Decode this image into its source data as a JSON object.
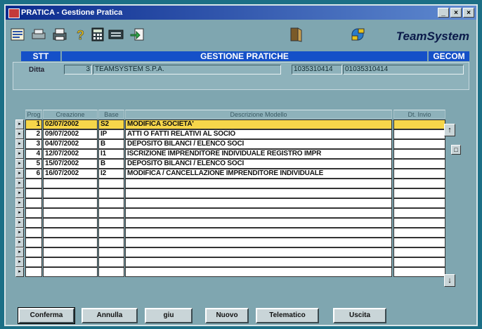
{
  "window": {
    "title": "PRATICA - Gestione Pratica",
    "controls": [
      "_",
      "×",
      "×"
    ]
  },
  "toolbar": {
    "brand": "TeamSystem"
  },
  "header": {
    "left": "STT",
    "center": "GESTIONE PRATICHE",
    "right": "GECOM",
    "ditta_label": "Ditta",
    "ditta_code": "3",
    "ditta_name": "TEAMSYSTEM S.P.A.",
    "piva": "1035310414",
    "cf": "01035310414"
  },
  "grid": {
    "columns": [
      "Prog",
      "Creazione",
      "Base",
      "Descrizione Modello",
      "Dt. Invio"
    ],
    "rows": [
      {
        "prog": "1",
        "data": "02/07/2002",
        "base": "S2",
        "desc": "MODIFICA SOCIETA'",
        "invio": ""
      },
      {
        "prog": "2",
        "data": "09/07/2002",
        "base": "IP",
        "desc": "ATTI O FATTI RELATIVI AL SOCIO",
        "invio": ""
      },
      {
        "prog": "3",
        "data": "04/07/2002",
        "base": "B",
        "desc": "DEPOSITO BILANCI / ELENCO SOCI",
        "invio": ""
      },
      {
        "prog": "4",
        "data": "12/07/2002",
        "base": "I1",
        "desc": "ISCRIZIONE IMPRENDITORE INDIVIDUALE REGISTRO IMPR",
        "invio": ""
      },
      {
        "prog": "5",
        "data": "15/07/2002",
        "base": "B",
        "desc": "DEPOSITO BILANCI / ELENCO SOCI",
        "invio": ""
      },
      {
        "prog": "6",
        "data": "16/07/2002",
        "base": "I2",
        "desc": "MODIFICA / CANCELLAZIONE IMPRENDITORE INDIVIDUALE",
        "invio": ""
      }
    ],
    "selected_row": 0,
    "empty_rows": 10
  },
  "buttons": {
    "conferma": "Conferma",
    "annulla": "Annulla",
    "giu": "giu",
    "nuovo": "Nuovo",
    "telematico": "Telematico",
    "uscita": "Uscita"
  },
  "colors": {
    "accent": "#1550c8",
    "selection": "#f6d64a",
    "panel": "#7fa6b0"
  }
}
